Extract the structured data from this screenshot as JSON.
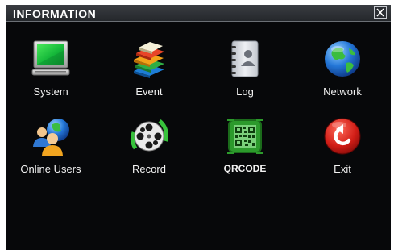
{
  "window": {
    "title": "INFORMATION",
    "close_icon": "close-icon"
  },
  "items": [
    {
      "label": "System",
      "icon": "monitor-icon"
    },
    {
      "label": "Event",
      "icon": "book-stack-icon"
    },
    {
      "label": "Log",
      "icon": "address-book-icon"
    },
    {
      "label": "Network",
      "icon": "globe-icon"
    },
    {
      "label": "Online Users",
      "icon": "users-globe-icon"
    },
    {
      "label": "Record",
      "icon": "film-reel-icon"
    },
    {
      "label": "QRCODE",
      "icon": "qrcode-icon"
    },
    {
      "label": "Exit",
      "icon": "exit-icon"
    }
  ],
  "colors": {
    "background": "#07080a",
    "titlebar": "#2e3135",
    "text": "#f2f2f2"
  }
}
